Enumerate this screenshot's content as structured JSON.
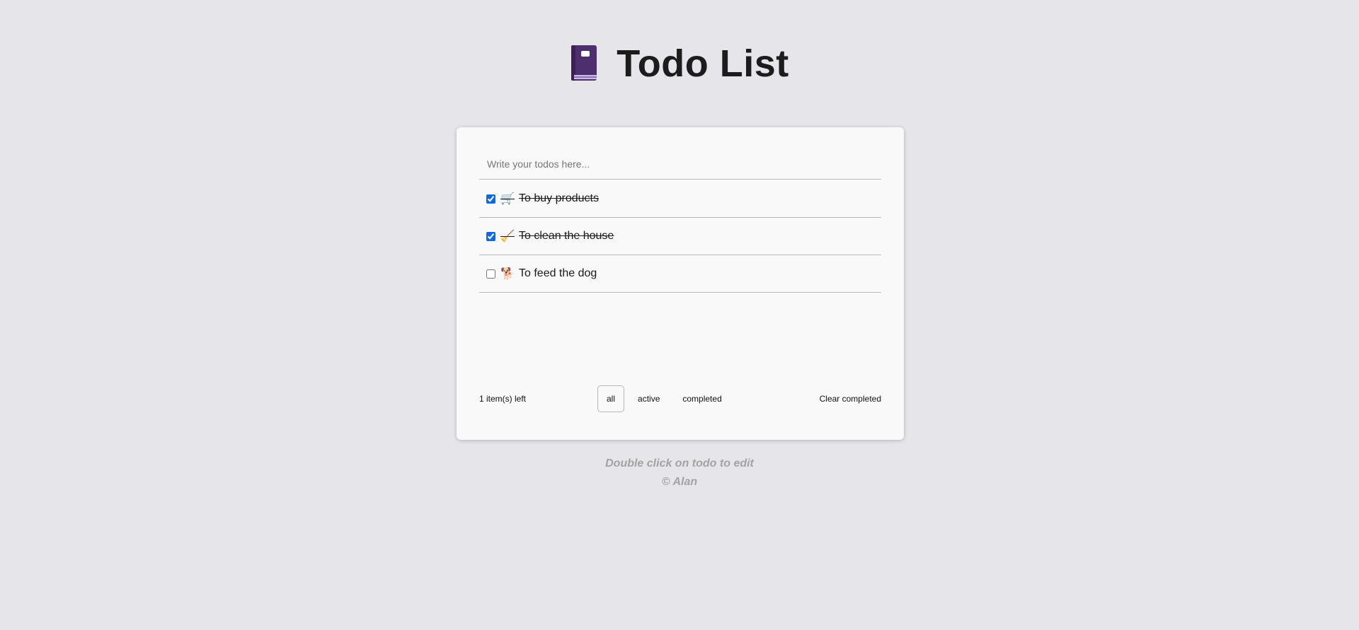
{
  "header": {
    "icon": "closed-book-icon",
    "title": "Todo List"
  },
  "input": {
    "placeholder": "Write your todos here...",
    "value": ""
  },
  "todos": [
    {
      "emoji": "🛒",
      "icon": "shopping-products-icon",
      "text": "To buy products",
      "completed": true
    },
    {
      "emoji": "🧹",
      "icon": "cleaning-broom-icon",
      "text": "To clean the house",
      "completed": true
    },
    {
      "emoji": "🐕",
      "icon": "dog-icon",
      "text": "To feed the dog",
      "completed": false
    }
  ],
  "footer": {
    "items_left": "1 item(s) left",
    "filters": [
      "all",
      "active",
      "completed"
    ],
    "selected_filter": "all",
    "clear_label": "Clear completed"
  },
  "notes": {
    "hint": "Double click on todo to edit",
    "credit": "© Alan"
  },
  "colors": {
    "background": "#e6e5ea",
    "card": "#f9f9f9",
    "checkbox_accent": "#0b6ae3",
    "book": "#4d2e6f",
    "note_text": "#a3a3a3"
  }
}
